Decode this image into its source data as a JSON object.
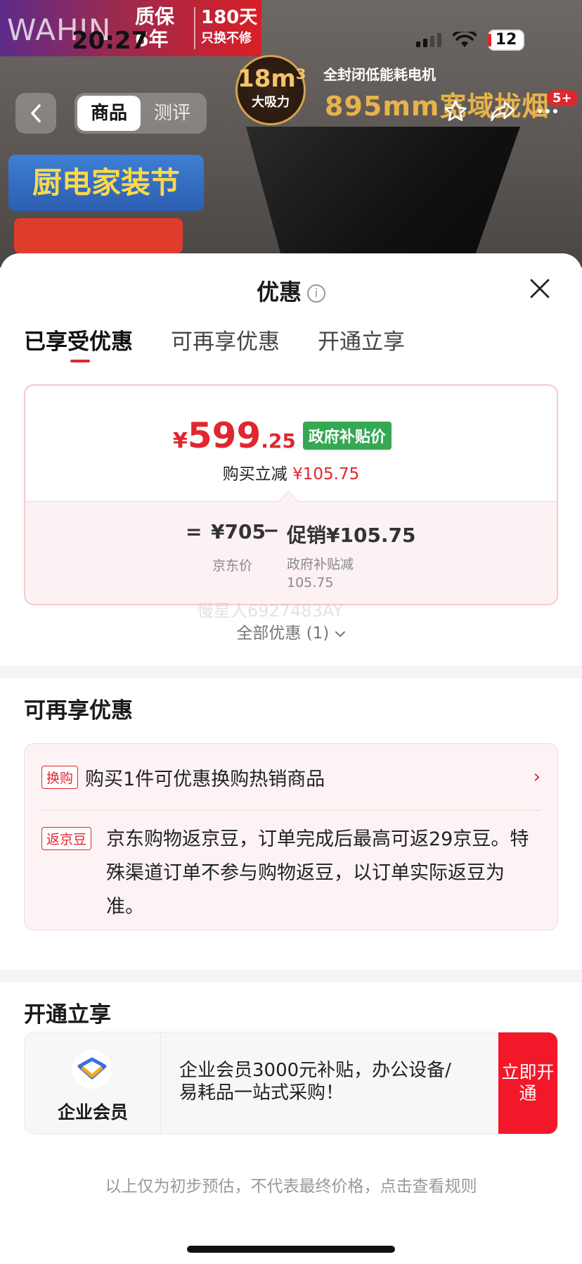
{
  "status_bar": {
    "time": "20:27",
    "battery": "12"
  },
  "background_page": {
    "brand": "WAHIN",
    "warranty_main": "质保\n6年",
    "warranty_days": "180天",
    "warranty_days_sub": "只换不修",
    "suction_value": "18m³",
    "suction_label": "大吸力",
    "slogan_1": "全封闭低能耗电机",
    "slogan_2": "895mm宽域拢烟",
    "festival": "厨电家装节",
    "nav_tab_product": "商品",
    "nav_tab_review": "测评",
    "message_badge": "5+"
  },
  "sheet": {
    "title": "优惠",
    "tabs": [
      "已享受优惠",
      "可再享优惠",
      "开通立享"
    ],
    "price_card": {
      "currency": "¥",
      "price_int": "599",
      "price_dec": ".25",
      "gov_tag": "政府补贴价",
      "cut_label": "购买立减",
      "cut_amount": "¥105.75",
      "equals": "=",
      "jd_price": "¥705",
      "jd_label": "京东价",
      "minus": "−",
      "promo": "促销¥105.75",
      "promo_label": "政府补贴减\n105.75"
    },
    "watermark": "慢星人6927483AY",
    "all_offers": "全部优惠 (1)",
    "more_offers": {
      "title": "可再享优惠",
      "items": [
        {
          "tag": "换购",
          "text": "购买1件可优惠换购热销商品"
        },
        {
          "tag": "返京豆",
          "text": "京东购物返京豆，订单完成后最高可返29京豆。特殊渠道订单不参与购物返豆，以订单实际返豆为准。"
        }
      ]
    },
    "membership": {
      "title": "开通立享",
      "name": "企业会员",
      "description": "企业会员3000元补贴，办公设备/易耗品一站式采购！",
      "button": "立即开通"
    },
    "footer_note": "以上仅为初步预估，不代表最终价格，点击查看规则"
  },
  "colors": {
    "accent_red": "#e0262e",
    "gov_green": "#35a853"
  }
}
